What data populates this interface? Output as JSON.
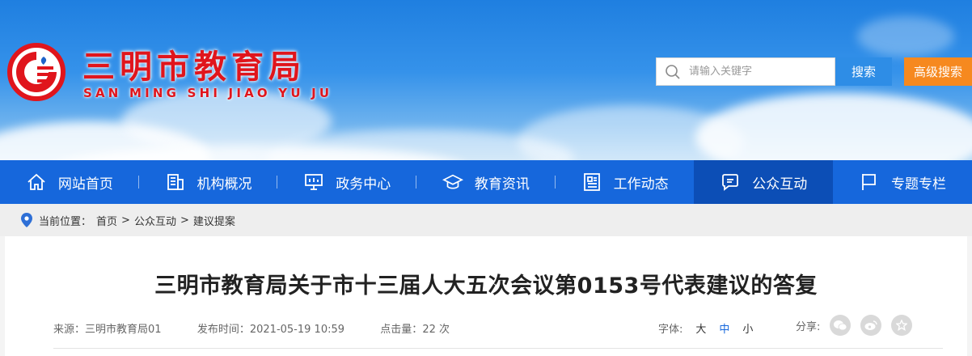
{
  "header": {
    "title": "三明市教育局",
    "subtitle": "SAN MING SHI JIAO YU JU",
    "search_placeholder": "请输入关键字",
    "search_button": "搜索",
    "advanced_button": "高级搜索",
    "brand_red": "#e0151c"
  },
  "nav": {
    "items": [
      {
        "label": "网站首页",
        "icon": "home-icon"
      },
      {
        "label": "机构概况",
        "icon": "building-icon"
      },
      {
        "label": "政务中心",
        "icon": "presentation-icon"
      },
      {
        "label": "教育资讯",
        "icon": "graduation-cap-icon"
      },
      {
        "label": "工作动态",
        "icon": "newspaper-icon"
      },
      {
        "label": "公众互动",
        "icon": "chat-icon",
        "active": true
      },
      {
        "label": "专题专栏",
        "icon": "flag-icon"
      }
    ],
    "bg": "#1667dc",
    "active_bg": "#0c4eb6"
  },
  "breadcrumb": {
    "prefix": "当前位置：",
    "items": [
      "首页",
      "公众互动",
      "建议提案"
    ],
    "separator": ">"
  },
  "article": {
    "title": "三明市教育局关于市十三届人大五次会议第0153号代表建议的答复",
    "source_label": "来源：",
    "source": "三明市教育局01",
    "date_label": "发布时间：",
    "date": "2021-05-19 10:59",
    "views_label": "点击量：",
    "views": "22 次",
    "font_label": "字体:",
    "font_large": "大",
    "font_mid": "中",
    "font_small": "小",
    "share_label": "分享:"
  }
}
